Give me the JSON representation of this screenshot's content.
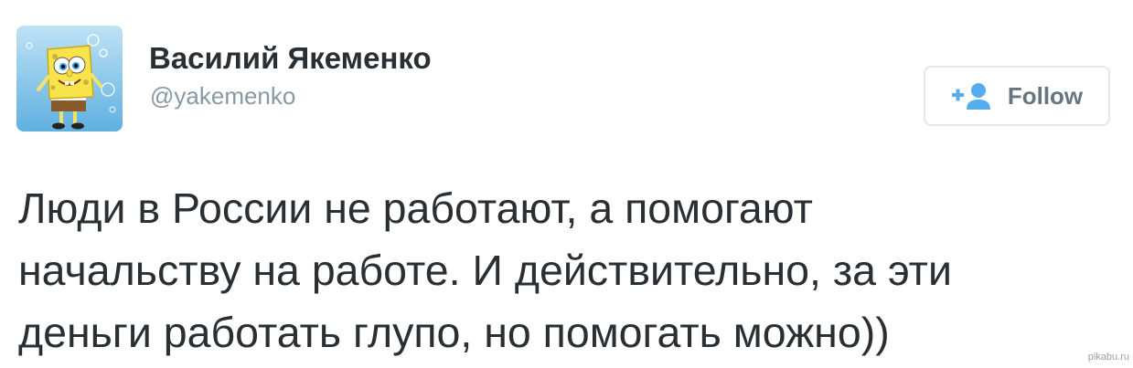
{
  "author": {
    "display_name": "Василий Якеменко",
    "handle": "@yakemenko",
    "avatar_icon": "spongebob-avatar"
  },
  "follow_button": {
    "label": "Follow",
    "icon": "add-user-icon",
    "accent_color": "#55acee"
  },
  "tweet": {
    "lines": [
      "Люди в России не работают, а помогают",
      "начальству на работе. И действительно, за эти",
      "деньги работать глупо, но помогать можно))"
    ]
  },
  "watermark": {
    "text": "pikabu.ru"
  }
}
